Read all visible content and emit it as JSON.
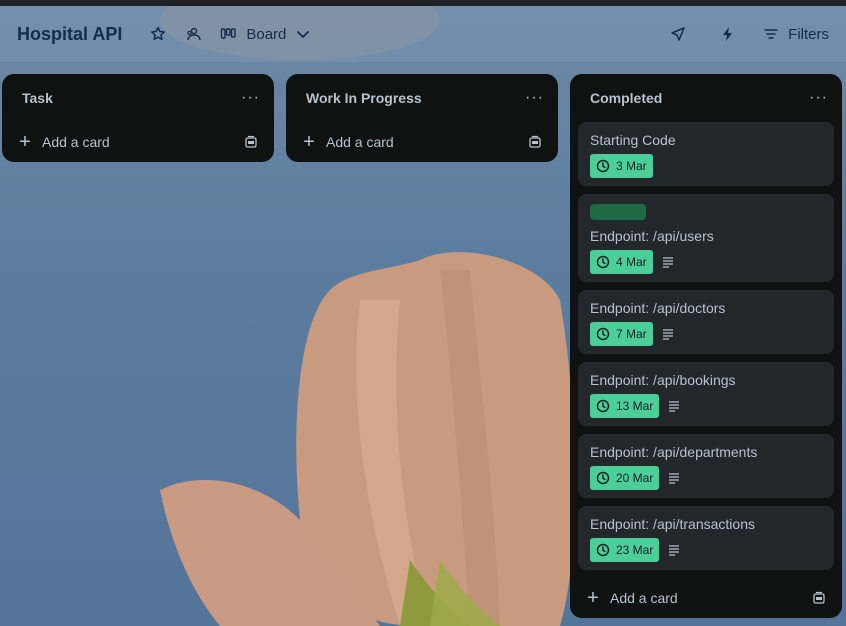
{
  "board": {
    "title": "Hospital API",
    "view_label": "Board",
    "filters_label": "Filters"
  },
  "icons": {
    "star": "star-icon",
    "workspace": "workspace-visibility-icon",
    "board_view": "board-view-icon",
    "chevron": "chevron-down-icon",
    "power_ups": "rocket-icon",
    "automation": "lightning-icon",
    "filter": "filter-icon",
    "clock": "clock-icon",
    "description": "description-icon",
    "template": "card-template-icon"
  },
  "colors": {
    "due_complete": "#4bce97",
    "label_green": "#1f6a45",
    "list_bg": "#101204",
    "card_bg": "#22272b"
  },
  "lists": [
    {
      "title": "Task",
      "menu": "···",
      "add_card": "Add a card"
    },
    {
      "title": "Work In Progress",
      "menu": "···",
      "add_card": "Add a card"
    },
    {
      "title": "Completed",
      "menu": "···",
      "add_card": "Add a card"
    }
  ],
  "completed_cards": [
    {
      "title": "Starting Code",
      "due": "3 Mar",
      "has_label": false,
      "has_description": false
    },
    {
      "title": "Endpoint: /api/users",
      "due": "4 Mar",
      "has_label": true,
      "has_description": true
    },
    {
      "title": "Endpoint: /api/doctors",
      "due": "7 Mar",
      "has_label": false,
      "has_description": true
    },
    {
      "title": "Endpoint: /api/bookings",
      "due": "13 Mar",
      "has_label": false,
      "has_description": true
    },
    {
      "title": "Endpoint: /api/departments",
      "due": "20 Mar",
      "has_label": false,
      "has_description": true
    },
    {
      "title": "Endpoint: /api/transactions",
      "due": "23 Mar",
      "has_label": false,
      "has_description": true
    }
  ]
}
